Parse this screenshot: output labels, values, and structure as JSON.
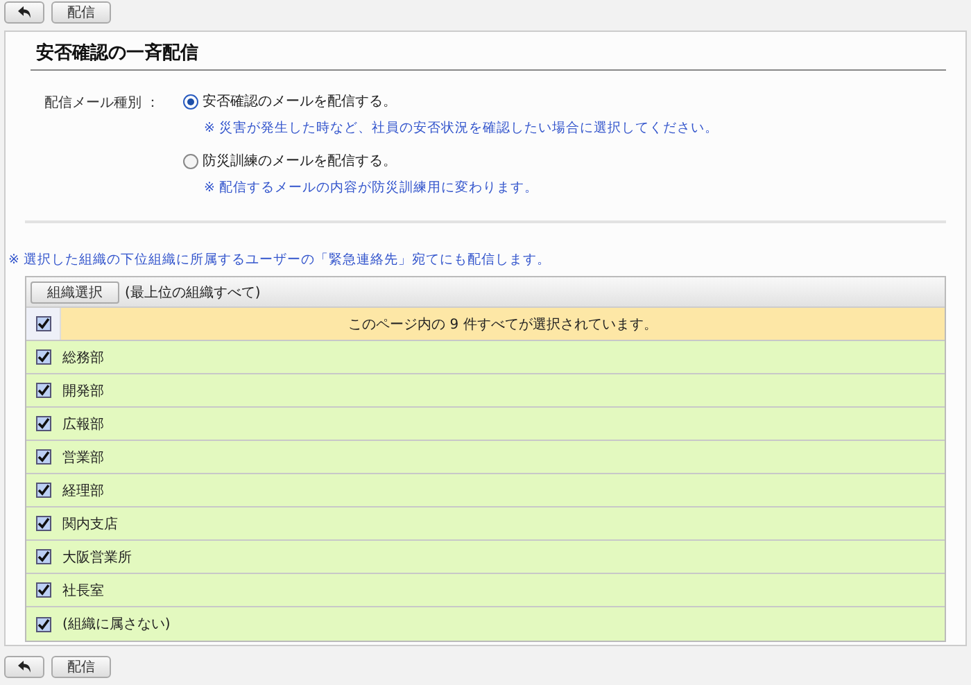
{
  "toolbar_top": {
    "buttons": [
      {
        "kind": "back"
      },
      {
        "kind": "text",
        "label": "配信"
      }
    ]
  },
  "title": "安否確認の一斉配信",
  "mail_type": {
    "label": "配信メール種別 ：",
    "options": [
      {
        "label": "安否確認のメールを配信する。",
        "note": "※ 災害が発生した時など、社員の安否状況を確認したい場合に選択してください。",
        "selected": true
      },
      {
        "label": "防災訓練のメールを配信する。",
        "note": "※ 配信するメールの内容が防災訓練用に変わります。",
        "selected": false
      }
    ]
  },
  "notice": "※ 選択した組織の下位組織に所属するユーザーの「緊急連絡先」宛てにも配信します。",
  "org_table": {
    "select_button": "組織選択",
    "scope": "(最上位の組織すべて)",
    "select_all": {
      "checked": true,
      "message": "このページ内の 9 件すべてが選択されています。"
    },
    "rows": [
      {
        "name": "総務部",
        "checked": true
      },
      {
        "name": "開発部",
        "checked": true
      },
      {
        "name": "広報部",
        "checked": true
      },
      {
        "name": "営業部",
        "checked": true
      },
      {
        "name": "経理部",
        "checked": true
      },
      {
        "name": "関内支店",
        "checked": true
      },
      {
        "name": "大阪営業所",
        "checked": true
      },
      {
        "name": "社長室",
        "checked": true
      },
      {
        "name": "(組織に属さない)",
        "checked": true
      }
    ]
  },
  "toolbar_bottom": {
    "buttons": [
      {
        "kind": "back"
      },
      {
        "kind": "text",
        "label": "配信"
      }
    ]
  }
}
